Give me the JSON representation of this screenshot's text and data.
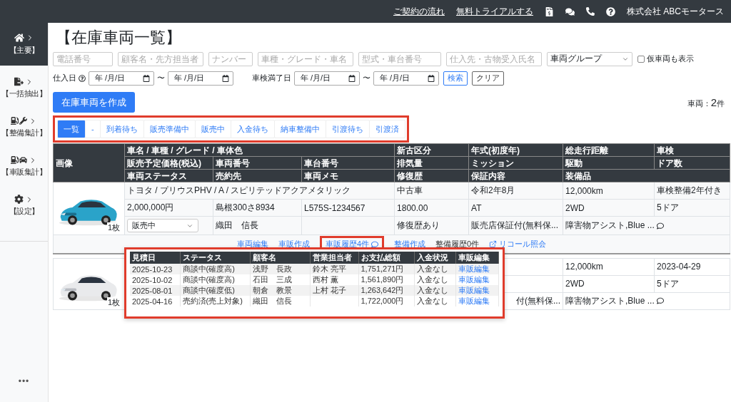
{
  "top_bar": {
    "links": [
      "ご契約の流れ",
      "無料トライアルする"
    ],
    "company": "株式会社 ABCモータース"
  },
  "sidebar": {
    "items": [
      {
        "label": "【主要】",
        "selected": true
      },
      {
        "label": "【一括抽出】",
        "selected": false
      },
      {
        "label": "【整備集計】",
        "selected": false
      },
      {
        "label": "【車販集計】",
        "selected": false
      },
      {
        "label": "【設定】",
        "selected": false
      }
    ],
    "more": "•••"
  },
  "title": "【在庫車両一覧】",
  "filters": {
    "fields": [
      {
        "placeholder": "電話番号"
      },
      {
        "placeholder": "顧客名・先方担当者"
      },
      {
        "placeholder": "ナンバー"
      },
      {
        "placeholder": "車種・グレード・車名"
      },
      {
        "placeholder": "型式・車台番号"
      },
      {
        "placeholder": "仕入先・古物受入氏名"
      }
    ],
    "group_select": "車両グループ",
    "temp_checkbox": {
      "label": "仮車両も表示",
      "checked": false
    },
    "date_ranges": [
      {
        "label": "仕入日",
        "help": true,
        "from": "年 /月/日",
        "to": "年 /月/日"
      },
      {
        "label": "車検満了日",
        "help": false,
        "from": "年 /月/日",
        "to": "年 /月/日"
      }
    ],
    "tilde": "〜",
    "search_button": "検索",
    "clear_button": "クリア"
  },
  "create_button": "在庫車両を作成",
  "count": {
    "label": "車両：",
    "value": "2",
    "unit": "件"
  },
  "tabs": [
    {
      "label": "一覧",
      "selected": true
    },
    {
      "label": "-",
      "selected": false
    },
    {
      "label": "到着待ち",
      "selected": false
    },
    {
      "label": "販売準備中",
      "selected": false
    },
    {
      "label": "販売中",
      "selected": false
    },
    {
      "label": "入金待ち",
      "selected": false
    },
    {
      "label": "納車整備中",
      "selected": false
    },
    {
      "label": "引渡待ち",
      "selected": false
    },
    {
      "label": "引渡済",
      "selected": false
    }
  ],
  "table": {
    "header_rows": [
      [
        "画像",
        "車名 / 車種 / グレード / 車体色",
        "新古区分",
        "年式(初度年)",
        "総走行距離",
        "車検"
      ],
      [
        "販売予定価格(税込)",
        "車両番号",
        "車台番号",
        "排気量",
        "ミッション",
        "駆動",
        "ドア数"
      ],
      [
        "車両ステータス",
        "売約先",
        "車両メモ",
        "修復歴",
        "保証内容",
        "装備品"
      ]
    ],
    "vehicles": [
      {
        "photo_count": "1枚",
        "name": "トヨタ / プリウスPHV / A / スピリテッドアクアメタリック",
        "new_used": "中古車",
        "year": "令和2年8月",
        "mileage": "12,000km",
        "inspection": "車検整備2年付き",
        "price": "2,000,000円",
        "plate": "島根300さ8934",
        "chassis": "L575S-1234567",
        "displacement": "1800.00",
        "transmission": "AT",
        "drive": "2WD",
        "doors": "5ドア",
        "status": "販売中",
        "buyer": "織田　信長",
        "repair": "修復歴あり",
        "warranty": "販売店保証付(無料保...",
        "equipment": "障害物アシスト,Blue ...",
        "comment": true,
        "actions": [
          {
            "label": "車両編集",
            "kind": "link",
            "highlighted": false
          },
          {
            "label": "車販作成",
            "kind": "link",
            "highlighted": false
          },
          {
            "label": "車販履歴4件",
            "kind": "comment_link",
            "highlighted": true
          },
          {
            "label": "整備作成",
            "kind": "link",
            "highlighted": false
          },
          {
            "label": "整備履歴0件",
            "kind": "text",
            "highlighted": false
          },
          {
            "label": "リコール照会",
            "kind": "external",
            "highlighted": false
          }
        ]
      },
      {
        "photo_count": "1枚",
        "mileage": "12,000km",
        "inspection": "2023-04-29",
        "drive": "2WD",
        "doors": "5ドア",
        "warranty": "付(無料保...",
        "equipment": "障害物アシスト,Blue ...",
        "comment": true
      }
    ]
  },
  "sales_history": {
    "columns": [
      "見積日",
      "ステータス",
      "顧客名",
      "営業担当者",
      "お支払総額",
      "入金状況",
      "車販編集"
    ],
    "rows": [
      [
        "2025-10-23",
        "商談中(確度高)",
        "浅野　長政",
        "鈴木 亮平",
        "1,751,271円",
        "入金なし",
        "車販編集"
      ],
      [
        "2025-10-02",
        "商談中(確度高)",
        "石田　三成",
        "西村 薫",
        "1,561,890円",
        "入金なし",
        "車販編集"
      ],
      [
        "2025-08-01",
        "商談中(確度低)",
        "朝倉　教景",
        "上村 花子",
        "1,263,642円",
        "入金なし",
        "車販編集"
      ],
      [
        "2025-04-16",
        "売約済(売上対象)",
        "織田　信長",
        "",
        "1,722,000円",
        "入金なし",
        "車販編集"
      ]
    ]
  }
}
